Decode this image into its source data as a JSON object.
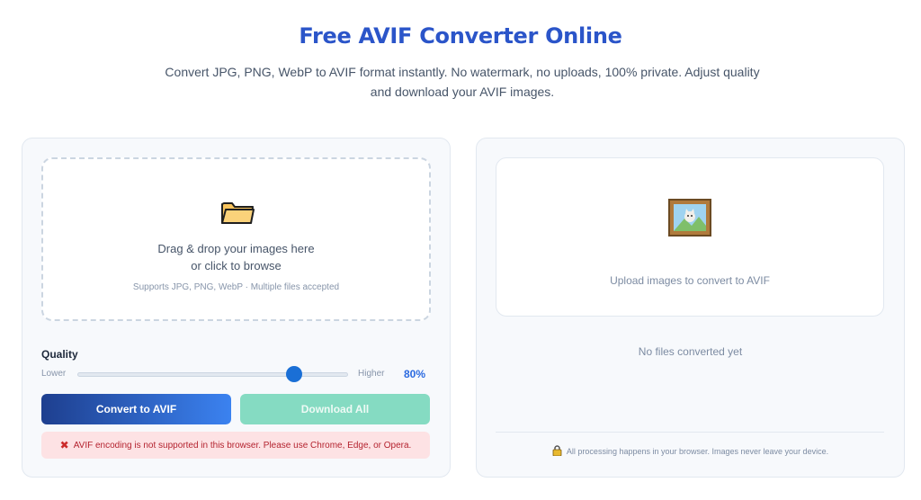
{
  "header": {
    "title": "Free AVIF Converter Online",
    "subtitle": "Convert JPG, PNG, WebP to AVIF format instantly. No watermark, no uploads, 100% private. Adjust quality and download your AVIF images."
  },
  "upload": {
    "icon": "folder-icon",
    "line1": "Drag & drop your images here",
    "line2": "or click to browse",
    "hint": "Supports JPG, PNG, WebP · Multiple files accepted"
  },
  "quality": {
    "label": "Quality",
    "lower_label": "Lower",
    "higher_label": "Higher",
    "value": 80,
    "value_text": "80%"
  },
  "buttons": {
    "convert": "Convert to AVIF",
    "download_all": "Download All"
  },
  "error": {
    "icon": "x-mark-icon",
    "text": "AVIF encoding is not supported in this browser. Please use Chrome, Edge, or Opera."
  },
  "preview": {
    "icon": "framed-picture-icon",
    "text": "Upload images to convert to AVIF"
  },
  "results": {
    "empty_text": "No files converted yet"
  },
  "footer": {
    "icon": "lock-icon",
    "privacy_text": "All processing happens in your browser. Images never leave your device."
  },
  "colors": {
    "title": "#2b55c9",
    "accent": "#1a6fd6",
    "convert_start": "#1e3f8f",
    "convert_end": "#3b82f0",
    "download": "#85dbc2",
    "error_bg": "#fde2e4",
    "error_text": "#b4232f"
  }
}
